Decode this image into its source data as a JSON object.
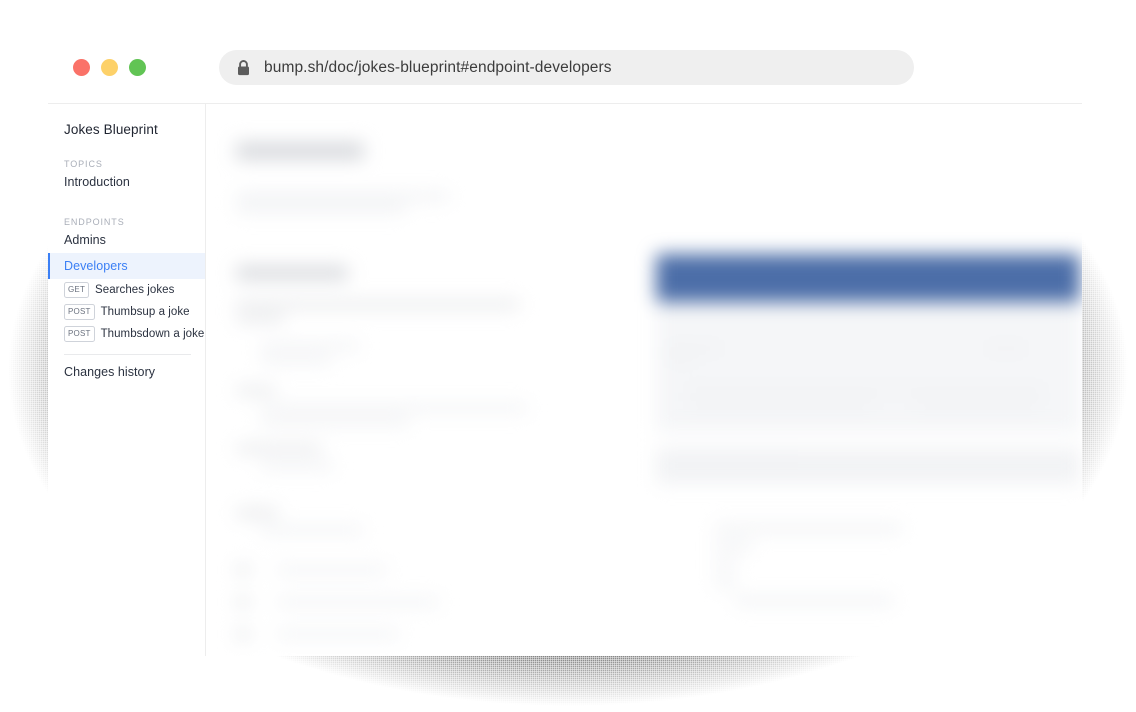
{
  "window": {
    "traffic_lights": [
      {
        "name": "close",
        "color": "#fa7268"
      },
      {
        "name": "minimize",
        "color": "#fdd169"
      },
      {
        "name": "maximize",
        "color": "#61c454"
      }
    ]
  },
  "address_bar": {
    "lock_icon": "lock-icon",
    "url": "bump.sh/doc/jokes-blueprint#endpoint-developers"
  },
  "sidebar": {
    "doc_title": "Jokes Blueprint",
    "sections": [
      {
        "label": "TOPICS",
        "items": [
          {
            "label": "Introduction",
            "active": false
          }
        ]
      },
      {
        "label": "ENDPOINTS",
        "items": [
          {
            "label": "Admins",
            "active": false
          },
          {
            "label": "Developers",
            "active": true
          }
        ]
      }
    ],
    "endpoints": [
      {
        "method": "GET",
        "label": "Searches jokes"
      },
      {
        "method": "POST",
        "label": "Thumbsup a joke"
      },
      {
        "method": "POST",
        "label": "Thumbsdown a joke"
      }
    ],
    "footer_item": "Changes history"
  },
  "colors": {
    "accent_blue": "#3b7ff5",
    "active_bg": "#edf3fd",
    "panel_blue": "#4c6ea8",
    "url_bar_bg": "#efefef",
    "divider": "#ededed"
  }
}
